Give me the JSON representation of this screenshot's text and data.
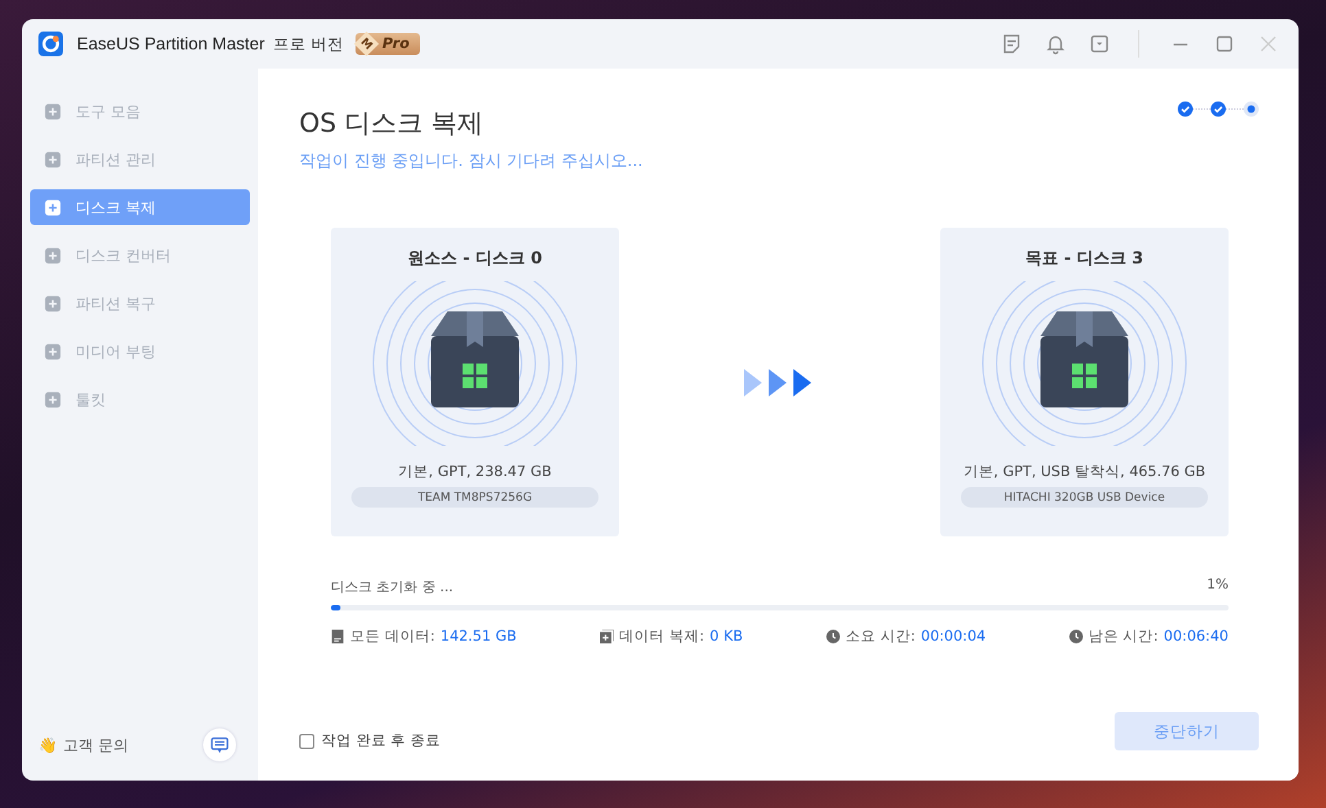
{
  "window": {
    "app_name": "EaseUS Partition Master",
    "edition": "프로 버전",
    "badge_letter": "M",
    "badge_text": "Pro"
  },
  "sidebar": {
    "items": [
      {
        "label": "도구 모음",
        "selected": false,
        "disabled": true
      },
      {
        "label": "파티션 관리",
        "selected": false,
        "disabled": true
      },
      {
        "label": "디스크 복제",
        "selected": true,
        "disabled": false
      },
      {
        "label": "디스크 컨버터",
        "selected": false,
        "disabled": true
      },
      {
        "label": "파티션 복구",
        "selected": false,
        "disabled": true
      },
      {
        "label": "미디어 부팅",
        "selected": false,
        "disabled": true
      },
      {
        "label": "툴킷",
        "selected": false,
        "disabled": true
      }
    ],
    "support_emoji": "👋",
    "support": "고객 문의"
  },
  "page": {
    "title": "OS 디스크 복제",
    "subtitle": "작업이 진행 중입니다. 잠시 기다려 주십시오...",
    "steps": [
      {
        "done": true
      },
      {
        "done": true
      },
      {
        "done": false
      }
    ]
  },
  "source": {
    "heading": "원소스 - 디스크 0",
    "info": "기본, GPT, 238.47 GB",
    "model": "TEAM TM8PS7256G"
  },
  "target": {
    "heading": "목표 - 디스크 3",
    "info": "기본, GPT, USB 탈착식, 465.76 GB",
    "model": "HITACHI 320GB USB Device"
  },
  "progress": {
    "status": "디스크 초기화 중 ...",
    "percent": "1%",
    "level": 0.01
  },
  "stats": [
    {
      "label": "모든 데이터:",
      "value": "142.51 GB",
      "kind": "total"
    },
    {
      "label": "데이터 복제:",
      "value": "0 KB",
      "kind": "copied"
    },
    {
      "label": "소요 시간:",
      "value": "00:00:04",
      "kind": "time"
    },
    {
      "label": "남은 시간:",
      "value": "00:06:40",
      "kind": "time"
    }
  ],
  "shutdown_checkbox": {
    "label": "작업 완료 후 종료",
    "checked": false
  },
  "stop_button": {
    "label": "중단하기",
    "disabled": true
  }
}
